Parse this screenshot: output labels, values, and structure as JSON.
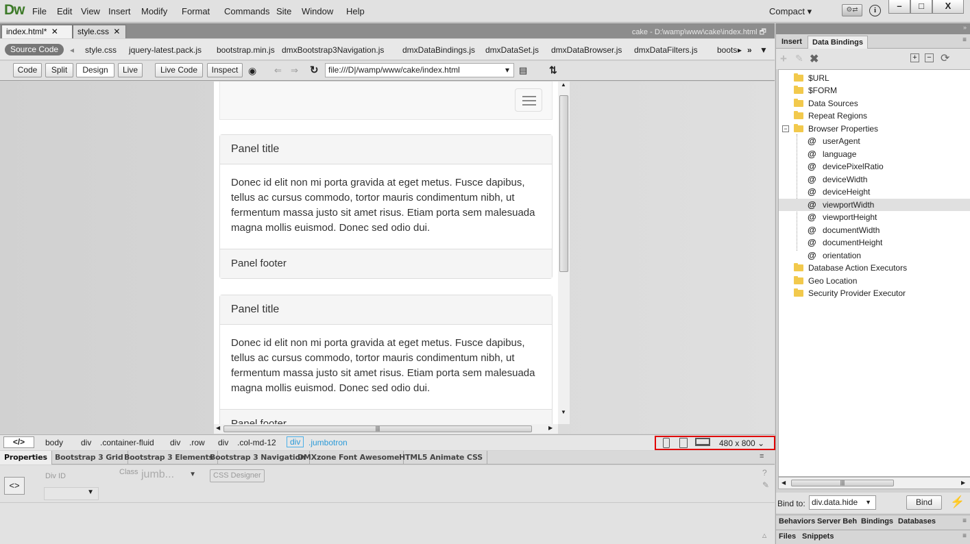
{
  "app": {
    "logo": "Dw",
    "menu": [
      "File",
      "Edit",
      "View",
      "Insert",
      "Modify",
      "Format",
      "Commands",
      "Site",
      "Window",
      "Help"
    ],
    "workspace": "Compact",
    "window_buttons": [
      "–",
      "□",
      "X"
    ]
  },
  "document_tabs": [
    {
      "label": "index.html*"
    },
    {
      "label": "style.css"
    }
  ],
  "doc_path": "cake - D:\\wamp\\www\\cake\\index.html",
  "related_files": {
    "source_label": "Source Code",
    "files": [
      "style.css",
      "jquery-latest.pack.js",
      "bootstrap.min.js",
      "dmxBootstrap3Navigation.js",
      "dmxDataBindings.js",
      "dmxDataSet.js",
      "dmxDataBrowser.js",
      "dmxDataFilters.js",
      "boots"
    ]
  },
  "toolbar": {
    "views": [
      "Code",
      "Split",
      "Design",
      "Live"
    ],
    "live_code": "Live Code",
    "inspect": "Inspect",
    "address": "file:///D|/wamp/www/cake/index.html"
  },
  "page": {
    "panels": [
      {
        "title": "Panel title",
        "body": "Donec id elit non mi porta gravida at eget metus. Fusce dapibus, tellus ac cursus commodo, tortor mauris condimentum nibh, ut fermentum massa justo sit amet risus. Etiam porta sem malesuada magna mollis euismod. Donec sed odio dui.",
        "footer": "Panel footer"
      },
      {
        "title": "Panel title",
        "body": "Donec id elit non mi porta gravida at eget metus. Fusce dapibus, tellus ac cursus commodo, tortor mauris condimentum nibh, ut fermentum massa justo sit amet risus. Etiam porta sem malesuada magna mollis euismod. Donec sed odio dui.",
        "footer": "Panel footer"
      }
    ]
  },
  "tag_selector": {
    "root": "</>",
    "tags": [
      "body",
      "div",
      "div",
      "div",
      "div"
    ],
    "classes": [
      "",
      ".container-fluid",
      ".row",
      ".col-md-12",
      ".jumbotron"
    ],
    "window_size": "480 x 800"
  },
  "properties": {
    "tabs": [
      "Properties",
      "Bootstrap 3 Grid",
      "Bootstrap 3 Elements",
      "Bootstrap 3 Navigation",
      "DMXzone Font Awesome",
      "HTML5 Animate CSS"
    ],
    "div_id_label": "Div ID",
    "class_label": "Class",
    "class_value": "jumb...",
    "css_designer": "CSS Designer"
  },
  "right_panel": {
    "tabs": [
      "Insert",
      "Data Bindings"
    ],
    "tree": {
      "folders_top": [
        "$URL",
        "$FORM",
        "Data Sources",
        "Repeat Regions",
        "Browser Properties"
      ],
      "browser_props": [
        "userAgent",
        "language",
        "devicePixelRatio",
        "deviceWidth",
        "deviceHeight",
        "viewportWidth",
        "viewportHeight",
        "documentWidth",
        "documentHeight",
        "orientation"
      ],
      "folders_bottom": [
        "Database Action Executors",
        "Geo Location",
        "Security Provider Executor"
      ]
    },
    "bind_to_label": "Bind to:",
    "bind_to_value": "div.data.hide",
    "bind_button": "Bind",
    "bottom_tabs": [
      "Behaviors",
      "Server Beh",
      "Bindings",
      "Databases"
    ],
    "files_tabs": [
      "Files",
      "Snippets"
    ]
  }
}
